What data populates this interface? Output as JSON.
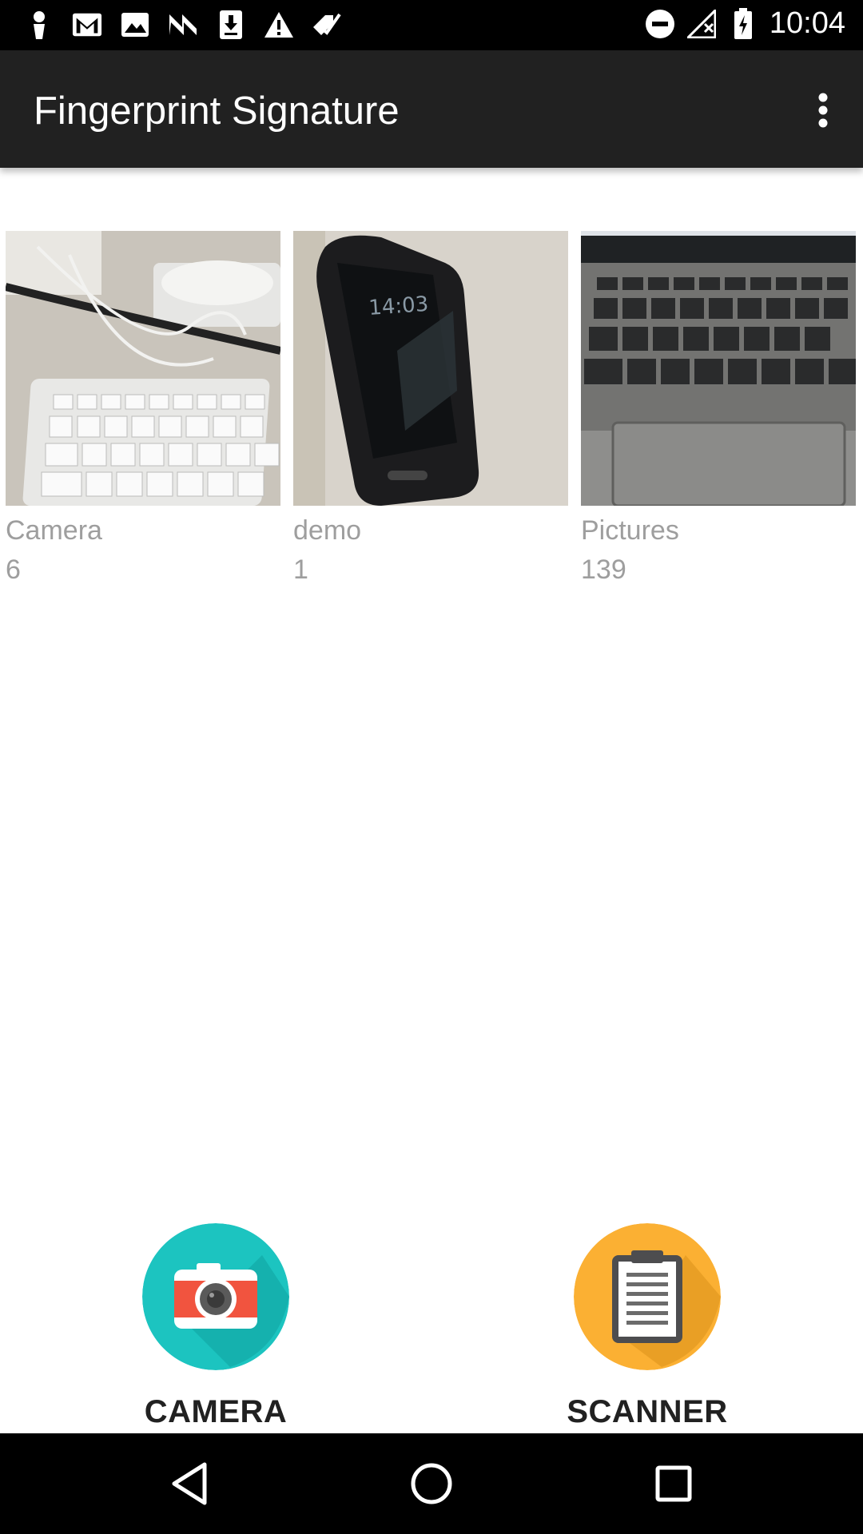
{
  "status_bar": {
    "time": "10:04",
    "left_icons": [
      "person-icon",
      "gmail-icon",
      "image-icon",
      "n-icon",
      "download-icon",
      "warning-icon",
      "check-tag-icon"
    ],
    "right_icons": [
      "dnd-icon",
      "no-signal-icon",
      "battery-icon"
    ]
  },
  "app_bar": {
    "title": "Fingerprint Signature",
    "overflow_icon": "more-vert-icon"
  },
  "albums": [
    {
      "name": "Camera",
      "count": "6"
    },
    {
      "name": "demo",
      "count": "1"
    },
    {
      "name": "Pictures",
      "count": "139"
    }
  ],
  "actions": {
    "camera_label": "CAMERA",
    "scanner_label": "SCANNER"
  },
  "colors": {
    "camera_teal": "#1cc4c0",
    "scanner_orange": "#fbb033",
    "app_bar": "#212121"
  },
  "nav_bar": {
    "icons": [
      "back-icon",
      "home-icon",
      "recents-icon"
    ]
  }
}
